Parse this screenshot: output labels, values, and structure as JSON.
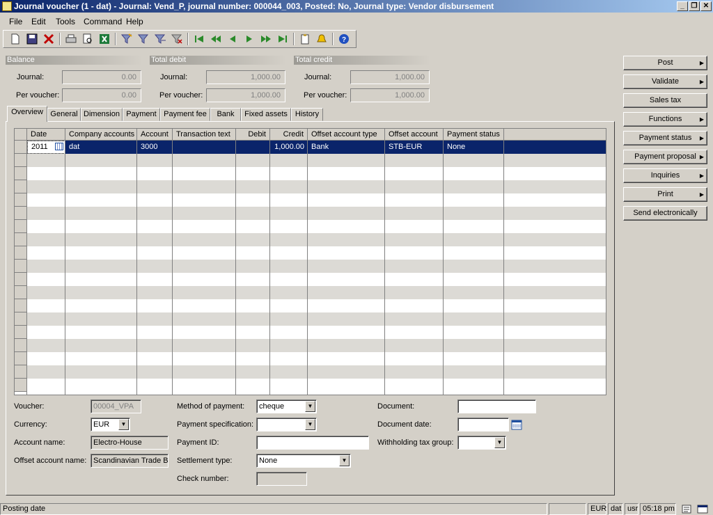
{
  "window": {
    "title": "Journal voucher (1 - dat) - Journal: Vend_P, journal number: 000044_003, Posted: No, Journal type: Vendor disbursement",
    "minimize": "_",
    "restore": "❐",
    "close": "✕"
  },
  "menu": [
    "File",
    "Edit",
    "Tools",
    "Command",
    "Help"
  ],
  "toolbar_icons": [
    "new-icon",
    "save-icon",
    "delete-icon",
    "print-icon",
    "print-preview-icon",
    "excel-icon",
    "filter-by-selection-icon",
    "filter-icon",
    "advanced-filter-icon",
    "remove-filter-icon",
    "first-record-icon",
    "previous-page-icon",
    "previous-record-icon",
    "next-record-icon",
    "next-page-icon",
    "last-record-icon",
    "document-handling-icon",
    "alert-icon",
    "help-icon"
  ],
  "totals": {
    "balance": {
      "title": "Balance",
      "journal_label": "Journal:",
      "journal": "0.00",
      "voucher_label": "Per voucher:",
      "voucher": "0.00"
    },
    "debit": {
      "title": "Total debit",
      "journal_label": "Journal:",
      "journal": "1,000.00",
      "voucher_label": "Per voucher:",
      "voucher": "1,000.00"
    },
    "credit": {
      "title": "Total credit",
      "journal_label": "Journal:",
      "journal": "1,000.00",
      "voucher_label": "Per voucher:",
      "voucher": "1,000.00"
    }
  },
  "tabs": [
    "Overview",
    "General",
    "Dimension",
    "Payment",
    "Payment fee",
    "Bank",
    "Fixed assets",
    "History"
  ],
  "grid": {
    "columns": [
      "Date",
      "Company accounts",
      "Account",
      "Transaction text",
      "Debit",
      "Credit",
      "Offset account type",
      "Offset account",
      "Payment status"
    ],
    "rows": [
      [
        "2011",
        "dat",
        "3000",
        "",
        "",
        "1,000.00",
        "Bank",
        "STB-EUR",
        "None"
      ]
    ]
  },
  "details": {
    "voucher_label": "Voucher:",
    "voucher": "00004_VPA",
    "currency_label": "Currency:",
    "currency": "EUR",
    "account_name_label": "Account name:",
    "account_name": "Electro-House",
    "offset_name_label": "Offset account name:",
    "offset_name": "Scandinavian Trade B",
    "method_label": "Method of payment:",
    "method": "cheque",
    "spec_label": "Payment specification:",
    "spec": "",
    "payment_id_label": "Payment ID:",
    "payment_id": "",
    "settlement_label": "Settlement type:",
    "settlement": "None",
    "check_label": "Check number:",
    "check": "",
    "document_label": "Document:",
    "document": "",
    "document_date_label": "Document date:",
    "document_date": "",
    "withholding_label": "Withholding tax group:",
    "withholding": ""
  },
  "actions": [
    "Post",
    "Validate",
    "Sales tax",
    "Functions",
    "Payment status",
    "Payment proposal",
    "Inquiries",
    "Print",
    "Send electronically"
  ],
  "status": {
    "text": "Posting date",
    "currency": "EUR",
    "company": "dat",
    "user": "usr",
    "time": "05:18 pm"
  }
}
